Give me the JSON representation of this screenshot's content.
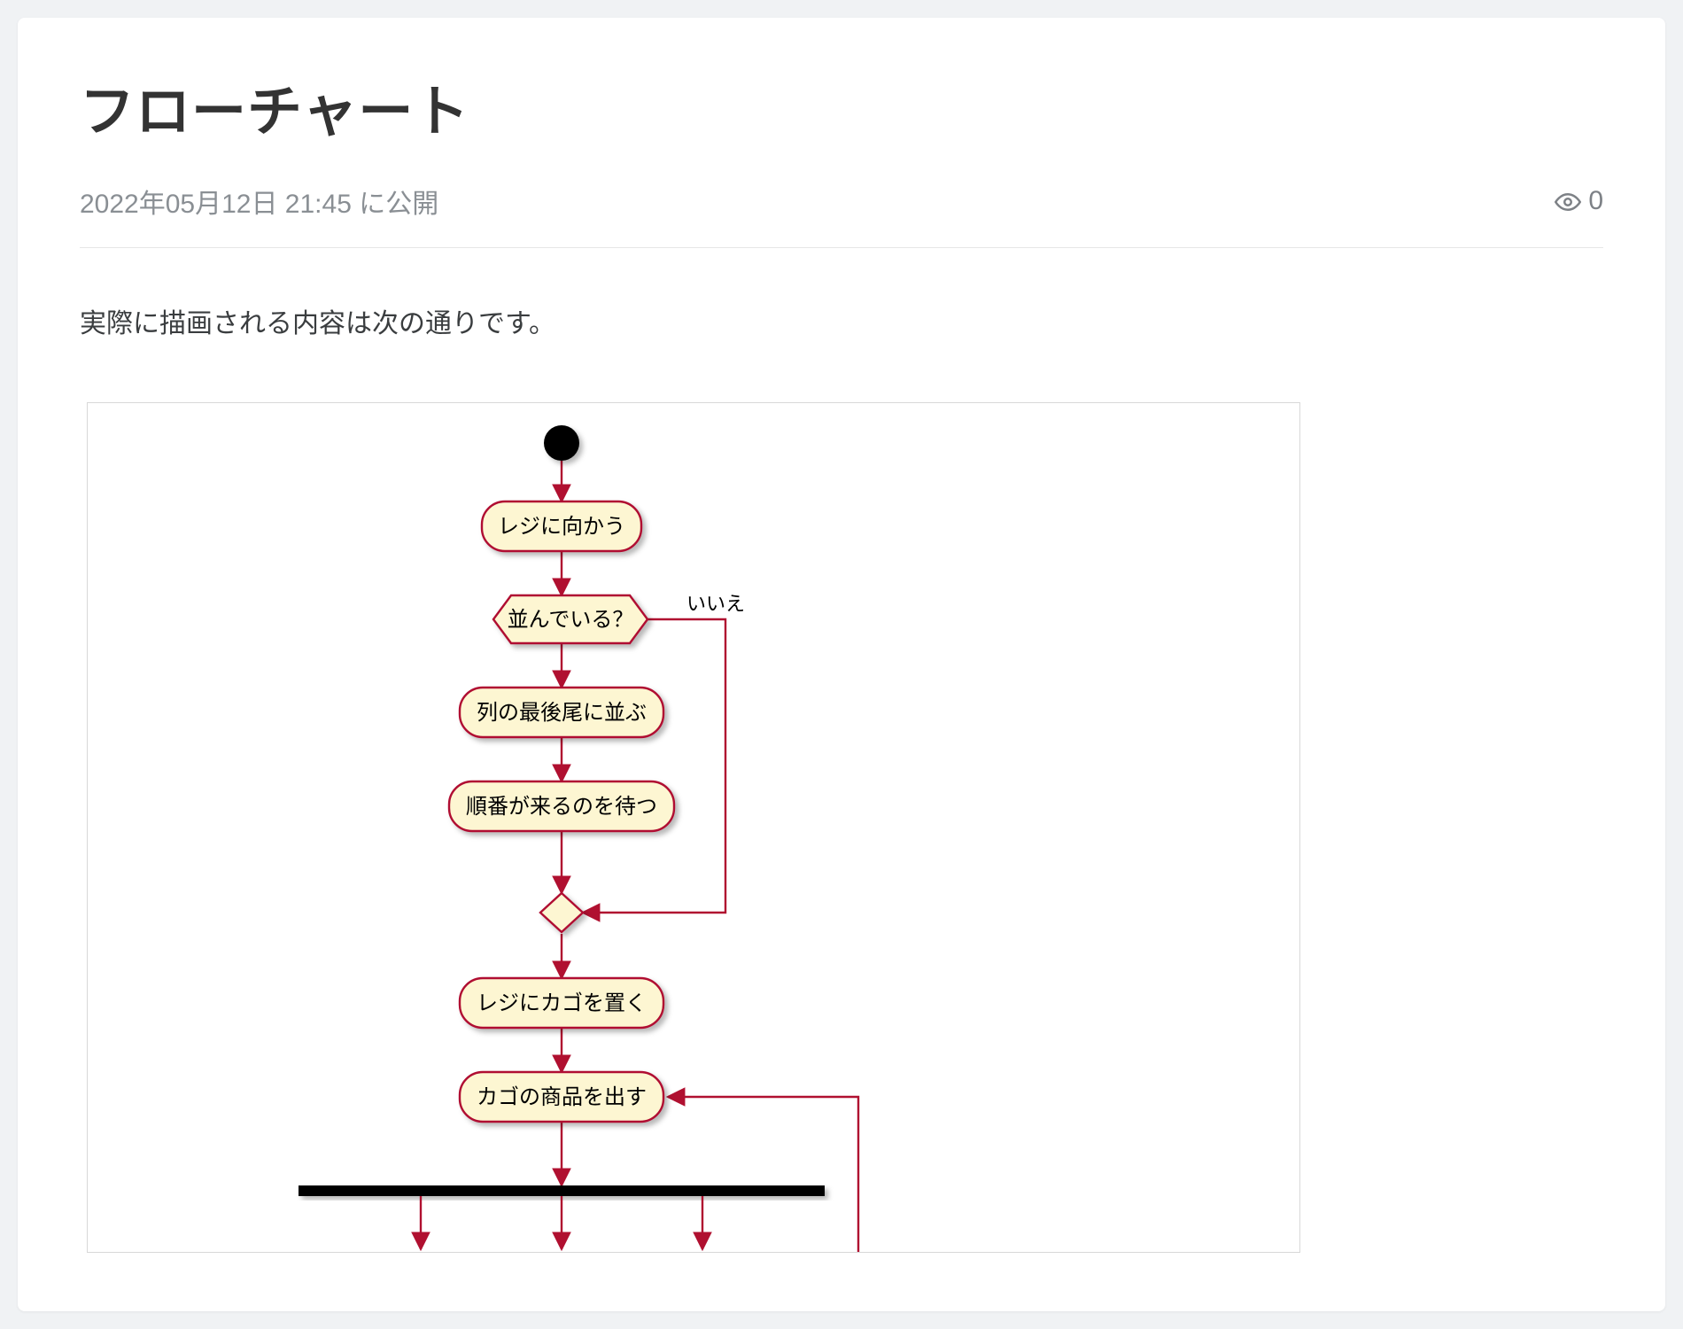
{
  "page": {
    "title": "フローチャート",
    "published_text": "2022年05月12日 21:45 に公開",
    "view_count": "0",
    "intro": "実際に描画される内容は次の通りです。"
  },
  "chart_data": {
    "type": "flowchart",
    "colors": {
      "stroke": "#b01030",
      "fill": "#fdf6d2",
      "text": "#000",
      "bar": "#000"
    },
    "nodes": [
      {
        "id": "start",
        "kind": "start",
        "label": ""
      },
      {
        "id": "n1",
        "kind": "activity",
        "label": "レジに向かう"
      },
      {
        "id": "d1",
        "kind": "decision",
        "label": "並んでいる？",
        "no_label": "いいえ"
      },
      {
        "id": "n2",
        "kind": "activity",
        "label": "列の最後尾に並ぶ"
      },
      {
        "id": "n3",
        "kind": "activity",
        "label": "順番が来るのを待つ"
      },
      {
        "id": "merge1",
        "kind": "merge",
        "label": ""
      },
      {
        "id": "n4",
        "kind": "activity",
        "label": "レジにカゴを置く"
      },
      {
        "id": "n5",
        "kind": "activity",
        "label": "カゴの商品を出す"
      },
      {
        "id": "fork",
        "kind": "fork",
        "label": ""
      }
    ],
    "edges": [
      [
        "start",
        "n1"
      ],
      [
        "n1",
        "d1"
      ],
      [
        "d1",
        "n2",
        "yes"
      ],
      [
        "d1",
        "merge1",
        "no"
      ],
      [
        "n2",
        "n3"
      ],
      [
        "n3",
        "merge1"
      ],
      [
        "merge1",
        "n4"
      ],
      [
        "n4",
        "n5"
      ],
      [
        "n5",
        "fork"
      ]
    ]
  }
}
